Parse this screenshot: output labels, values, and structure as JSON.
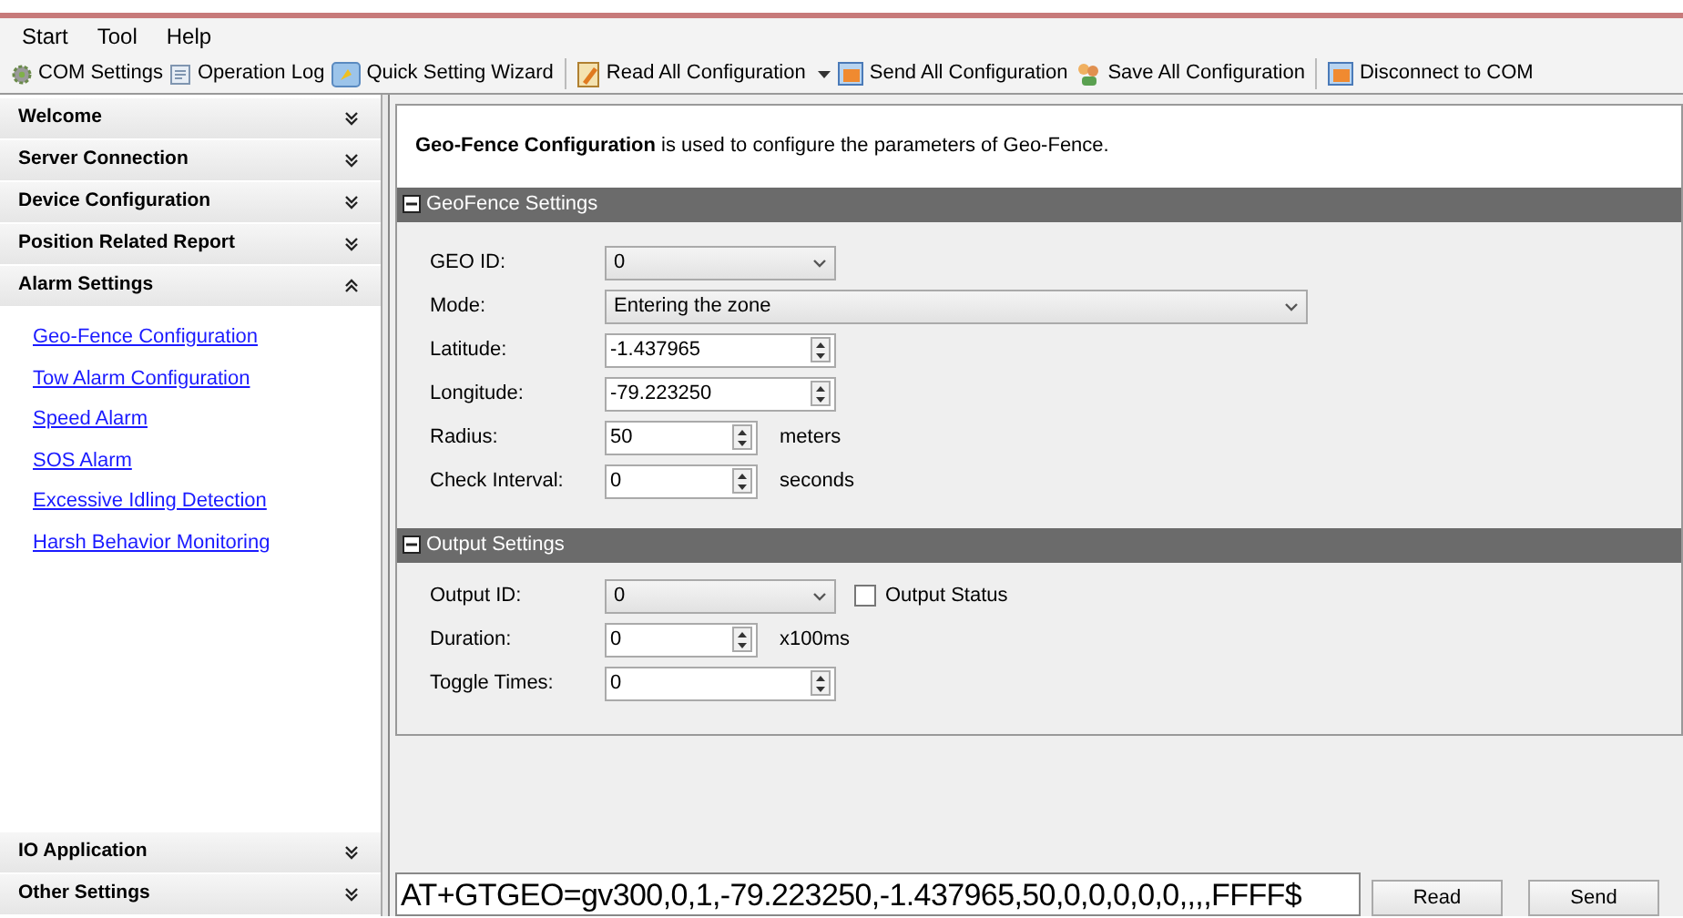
{
  "menu": [
    "Start",
    "Tool",
    "Help"
  ],
  "toolbar": [
    {
      "label": "COM Settings",
      "separator_before": false,
      "dropdown": false
    },
    {
      "label": "Operation Log",
      "separator_before": false,
      "dropdown": false
    },
    {
      "label": "Quick Setting Wizard",
      "separator_before": false,
      "dropdown": false
    },
    {
      "label": "Read All Configuration",
      "separator_before": true,
      "dropdown": true
    },
    {
      "label": "Send All Configuration",
      "separator_before": false,
      "dropdown": false
    },
    {
      "label": "Save All Configuration",
      "separator_before": false,
      "dropdown": false
    },
    {
      "label": "Disconnect to COM",
      "separator_before": true,
      "dropdown": false
    }
  ],
  "sidebar": {
    "sections": [
      {
        "label": "Welcome",
        "expanded": false
      },
      {
        "label": "Server Connection",
        "expanded": false
      },
      {
        "label": "Device Configuration",
        "expanded": false
      },
      {
        "label": "Position Related Report",
        "expanded": false
      },
      {
        "label": "Alarm Settings",
        "expanded": true,
        "children": [
          "Geo-Fence Configuration",
          "Tow Alarm Configuration",
          "Speed Alarm",
          "SOS Alarm",
          "Excessive Idling Detection",
          "Harsh Behavior Monitoring"
        ]
      }
    ],
    "bottom_sections": [
      {
        "label": "IO Application",
        "expanded": false
      },
      {
        "label": "Other Settings",
        "expanded": false
      }
    ]
  },
  "description": "**Geo-Fence Configuration**  is used to configure the parameters of Geo-Fence.",
  "groups": [
    {
      "title": "GeoFence Settings",
      "expanded": true,
      "fields": [
        {
          "kind": "select",
          "label": "GEO ID:",
          "value": "0"
        },
        {
          "kind": "combo",
          "label": "Mode:",
          "value": "Entering the zone"
        },
        {
          "kind": "spin",
          "label": "Latitude:",
          "value": "-1.437965"
        },
        {
          "kind": "spin",
          "label": "Longitude:",
          "value": "-79.223250"
        },
        {
          "kind": "spin",
          "label": "Radius:",
          "value": "50",
          "unit": "meters"
        },
        {
          "kind": "spin",
          "label": "Check Interval:",
          "value": "0",
          "unit": "seconds"
        }
      ]
    },
    {
      "title": "Output Settings",
      "expanded": true,
      "fields": [
        {
          "kind": "select",
          "label": "Output ID:",
          "value": "0",
          "checkbox": {
            "label": "Output Status",
            "checked": false
          }
        },
        {
          "kind": "spin",
          "label": "Duration:",
          "value": "0",
          "unit": "x100ms"
        },
        {
          "kind": "spin",
          "label": "Toggle Times:",
          "value": "0"
        }
      ]
    }
  ],
  "command": {
    "value": "AT+GTGEO=gv300,0,1,-79.223250,-1.437965,50,0,0,0,0,0,,,,FFFF$",
    "buttons": [
      "Read",
      "Send"
    ]
  }
}
